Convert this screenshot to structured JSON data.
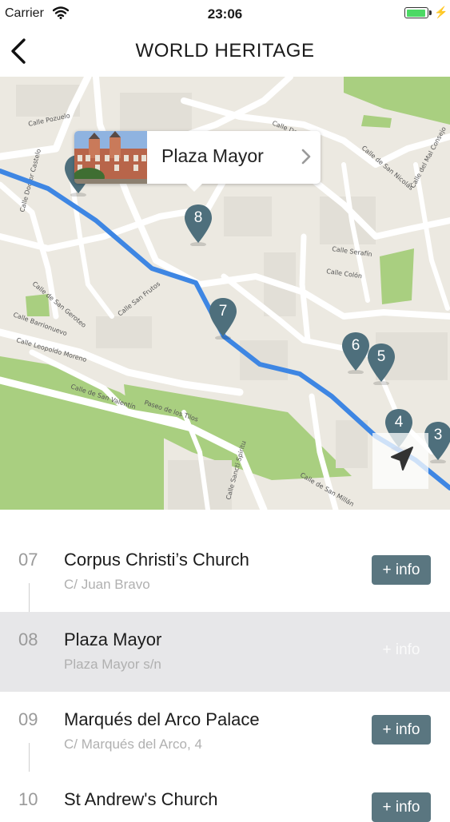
{
  "status_bar": {
    "carrier": "Carrier",
    "time": "23:06",
    "battery_level": 0.85
  },
  "nav": {
    "title": "WORLD HERITAGE",
    "back_icon": "chevron-left-icon"
  },
  "map": {
    "callout": {
      "title": "Plaza Mayor"
    },
    "markers": [
      "8",
      "7",
      "6",
      "5",
      "4",
      "3"
    ],
    "street_labels": [
      "Calle Pozuelo",
      "Calle Doctor Castelo",
      "Calle de San Geroteo",
      "Calle Barrionuevo",
      "Calle Leopoldo Moreno",
      "Calle de San Valentín",
      "Paseo de los Tilos",
      "Calle Serafín",
      "Calle Colón",
      "Calle de San Nicolás",
      "Calle del Mal Consejo",
      "Calle San Frutos",
      "Calle Daoíz",
      "Calle de San Millán",
      "Calle Sancti Spiritu"
    ],
    "colors": {
      "route": "#3e86e3",
      "marker": "#4e6f7c",
      "park": "#a8cf7e",
      "road": "#ffffff"
    }
  },
  "list": {
    "items": [
      {
        "number": "07",
        "name": "Corpus Christi’s Church",
        "address": "C/ Juan Bravo",
        "info_label": "+ info",
        "selected": false
      },
      {
        "number": "08",
        "name": "Plaza Mayor",
        "address": "Plaza Mayor s/n",
        "info_label": "+ info",
        "selected": true
      },
      {
        "number": "09",
        "name": "Marqués del Arco Palace",
        "address": "C/ Marqués del Arco, 4",
        "info_label": "+ info",
        "selected": false
      },
      {
        "number": "10",
        "name": "St Andrew's Church",
        "address": "",
        "info_label": "+ info",
        "selected": false
      }
    ]
  }
}
